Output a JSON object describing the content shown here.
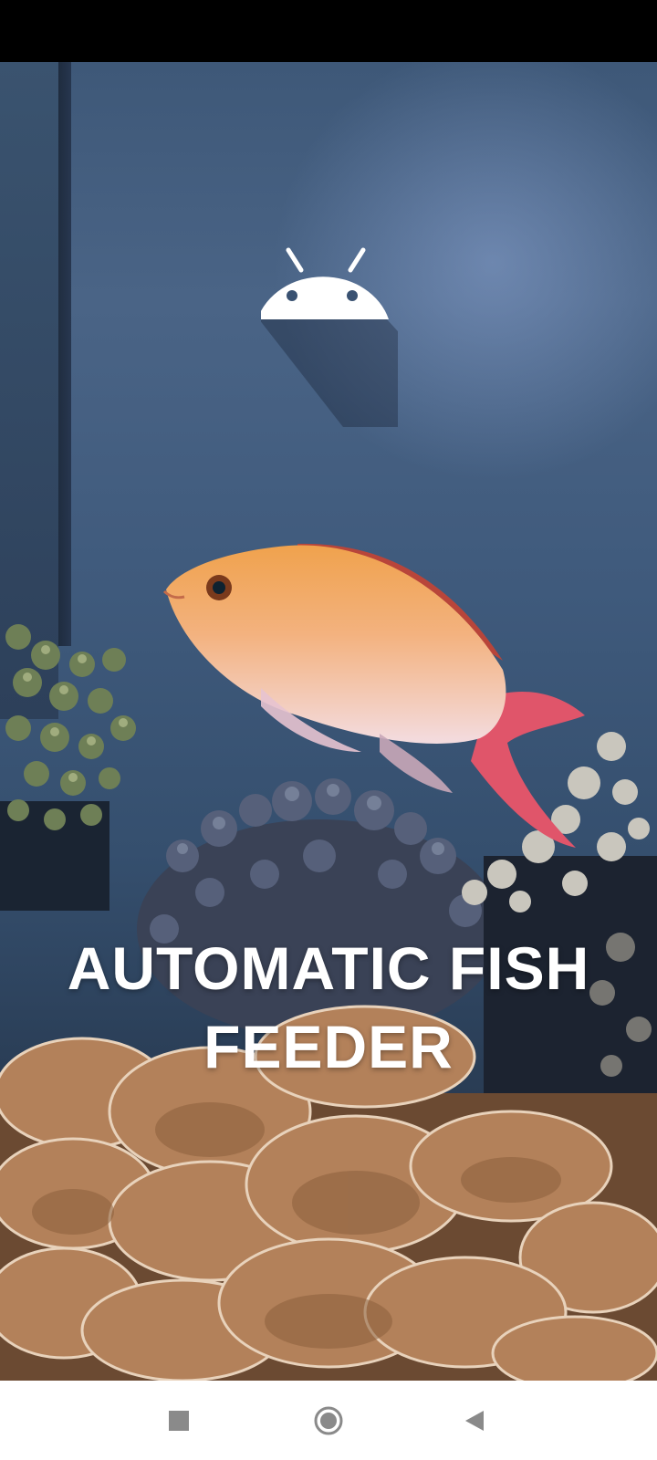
{
  "app": {
    "title": "AUTOMATIC FISH FEEDER"
  },
  "splash": {
    "logo_icon": "android-icon",
    "background": "aquarium-fish-photo"
  },
  "navigation_bar": {
    "recents_icon": "square-icon",
    "home_icon": "circle-icon",
    "back_icon": "triangle-back-icon"
  },
  "colors": {
    "status_bar": "#000000",
    "nav_bar": "#ffffff",
    "title_text": "#ffffff",
    "nav_icon": "#8a8a8a"
  }
}
